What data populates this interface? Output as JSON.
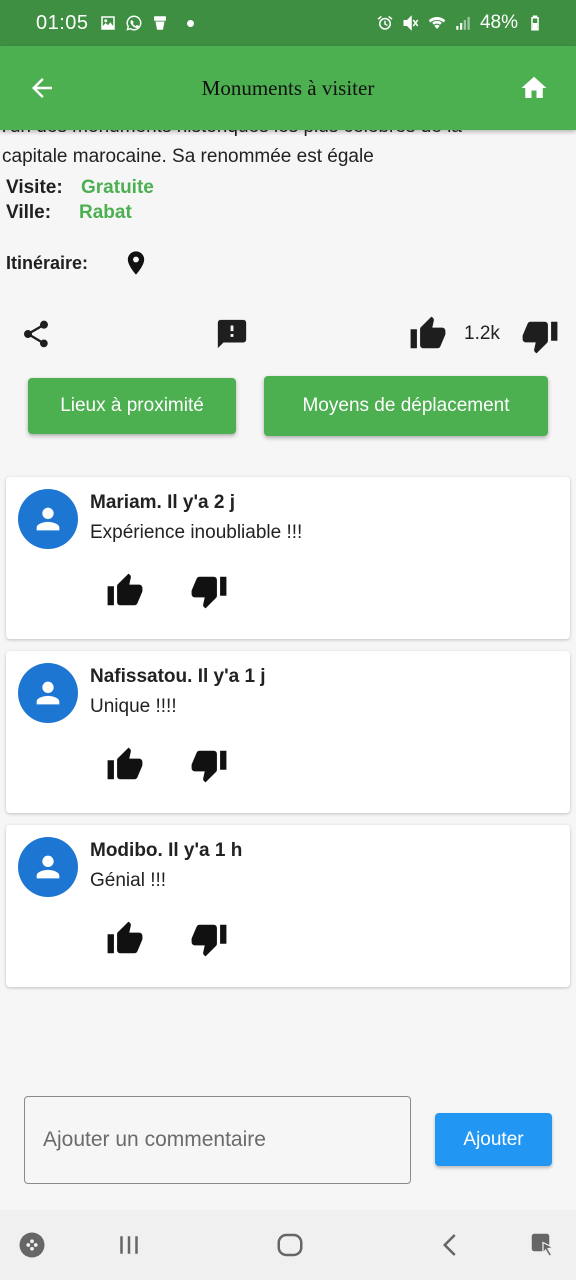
{
  "status_bar": {
    "time": "01:05",
    "battery": "48%",
    "left_icons": [
      "gallery-icon",
      "whatsapp-icon",
      "app-icon",
      "dot"
    ],
    "right_icons": [
      "alarm-icon",
      "mute-icon",
      "wifi-icon",
      "signal-icon",
      "battery-icon"
    ]
  },
  "app_bar": {
    "title": "Monuments à visiter",
    "back_icon": "arrow-back-icon",
    "home_icon": "home-icon"
  },
  "monument": {
    "description_line1": "l'un des monuments historiques les plus célèbres de la",
    "description_line2": "capitale marocaine. Sa renommée est égale",
    "visite_label": "Visite:",
    "visite_value": "Gratuite",
    "ville_label": "Ville:",
    "ville_value": "Rabat",
    "itineraire_label": "Itinéraire:",
    "likes_count": "1.2k"
  },
  "buttons": {
    "nearby": "Lieux à proximité",
    "transport": "Moyens de déplacement"
  },
  "comments": [
    {
      "author": "Mariam. Il y'a 2 j",
      "text": "Expérience inoubliable !!!"
    },
    {
      "author": "Nafissatou. Il y'a 1 j",
      "text": "Unique !!!!"
    },
    {
      "author": "Modibo. Il y'a 1 h",
      "text": "Génial !!!"
    }
  ],
  "comment_input": {
    "placeholder": "Ajouter un commentaire",
    "value": "",
    "submit_label": "Ajouter"
  },
  "colors": {
    "status_bar": "#3e8f42",
    "primary": "#4caf50",
    "accent_blue": "#2196f3",
    "avatar": "#1e76d3"
  }
}
